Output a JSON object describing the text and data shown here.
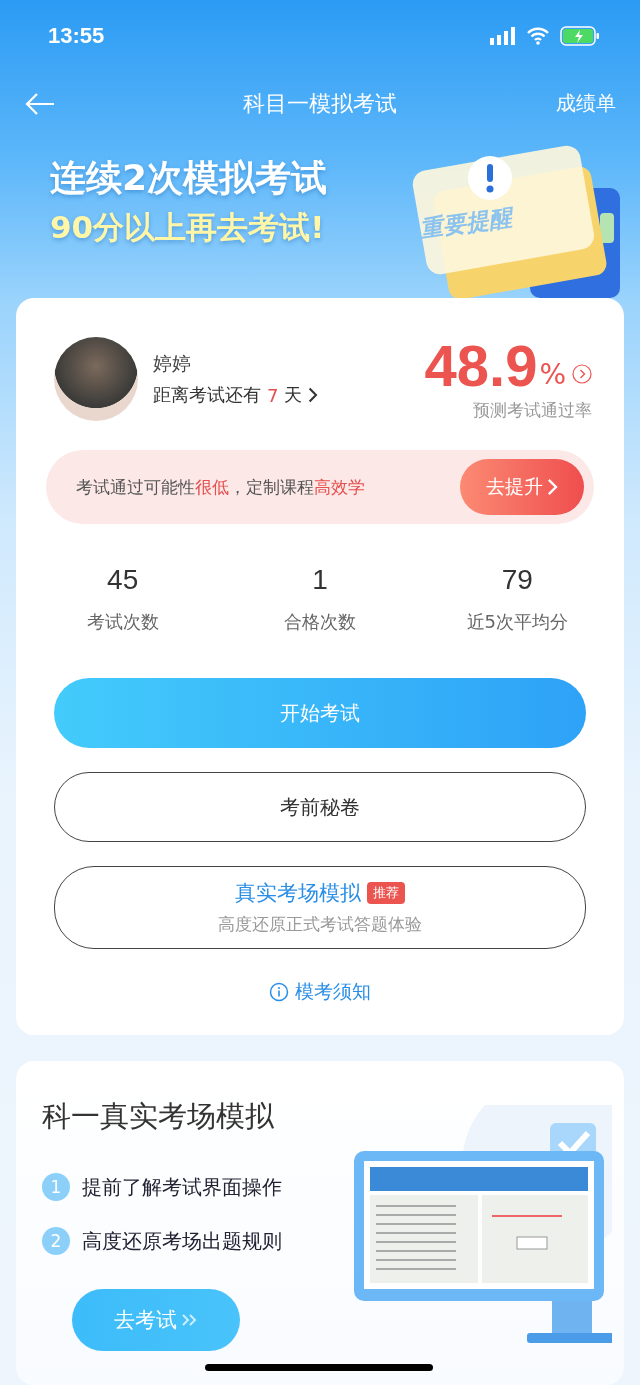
{
  "status_bar": {
    "time": "13:55"
  },
  "nav": {
    "title": "科目一模拟考试",
    "right_action": "成绩单"
  },
  "banner": {
    "line_1": "连续2次模拟考试",
    "line_2": "90分以上再去考试!",
    "badge_text": "重要提醒"
  },
  "profile": {
    "name": "婷婷",
    "countdown_prefix": "距离考试还有",
    "countdown_days": "7",
    "countdown_suffix": "天",
    "pass_rate": "48.9",
    "pass_rate_unit": "%",
    "pass_rate_label": "预测考试通过率"
  },
  "alert": {
    "segments": [
      {
        "text": "考试通过可能性",
        "highlight": false
      },
      {
        "text": "很低",
        "highlight": true
      },
      {
        "text": "，定制课程",
        "highlight": false
      },
      {
        "text": "高效学",
        "highlight": true
      }
    ],
    "button": "去提升"
  },
  "stats": [
    {
      "value": "45",
      "label": "考试次数"
    },
    {
      "value": "1",
      "label": "合格次数"
    },
    {
      "value": "79",
      "label": "近5次平均分"
    }
  ],
  "actions": [
    {
      "kind": "primary",
      "label": "开始考试"
    },
    {
      "kind": "outline",
      "label": "考前秘卷"
    },
    {
      "kind": "feature",
      "label": "真实考场模拟",
      "tag": "推荐",
      "subtitle": "高度还原正式考试答题体验"
    }
  ],
  "notice_link": "模考须知",
  "promo": {
    "title": "科一真实考场模拟",
    "points": [
      {
        "index": "1",
        "text": "提前了解考试界面操作"
      },
      {
        "index": "2",
        "text": "高度还原考场出题规则"
      }
    ],
    "button": "去考试"
  }
}
